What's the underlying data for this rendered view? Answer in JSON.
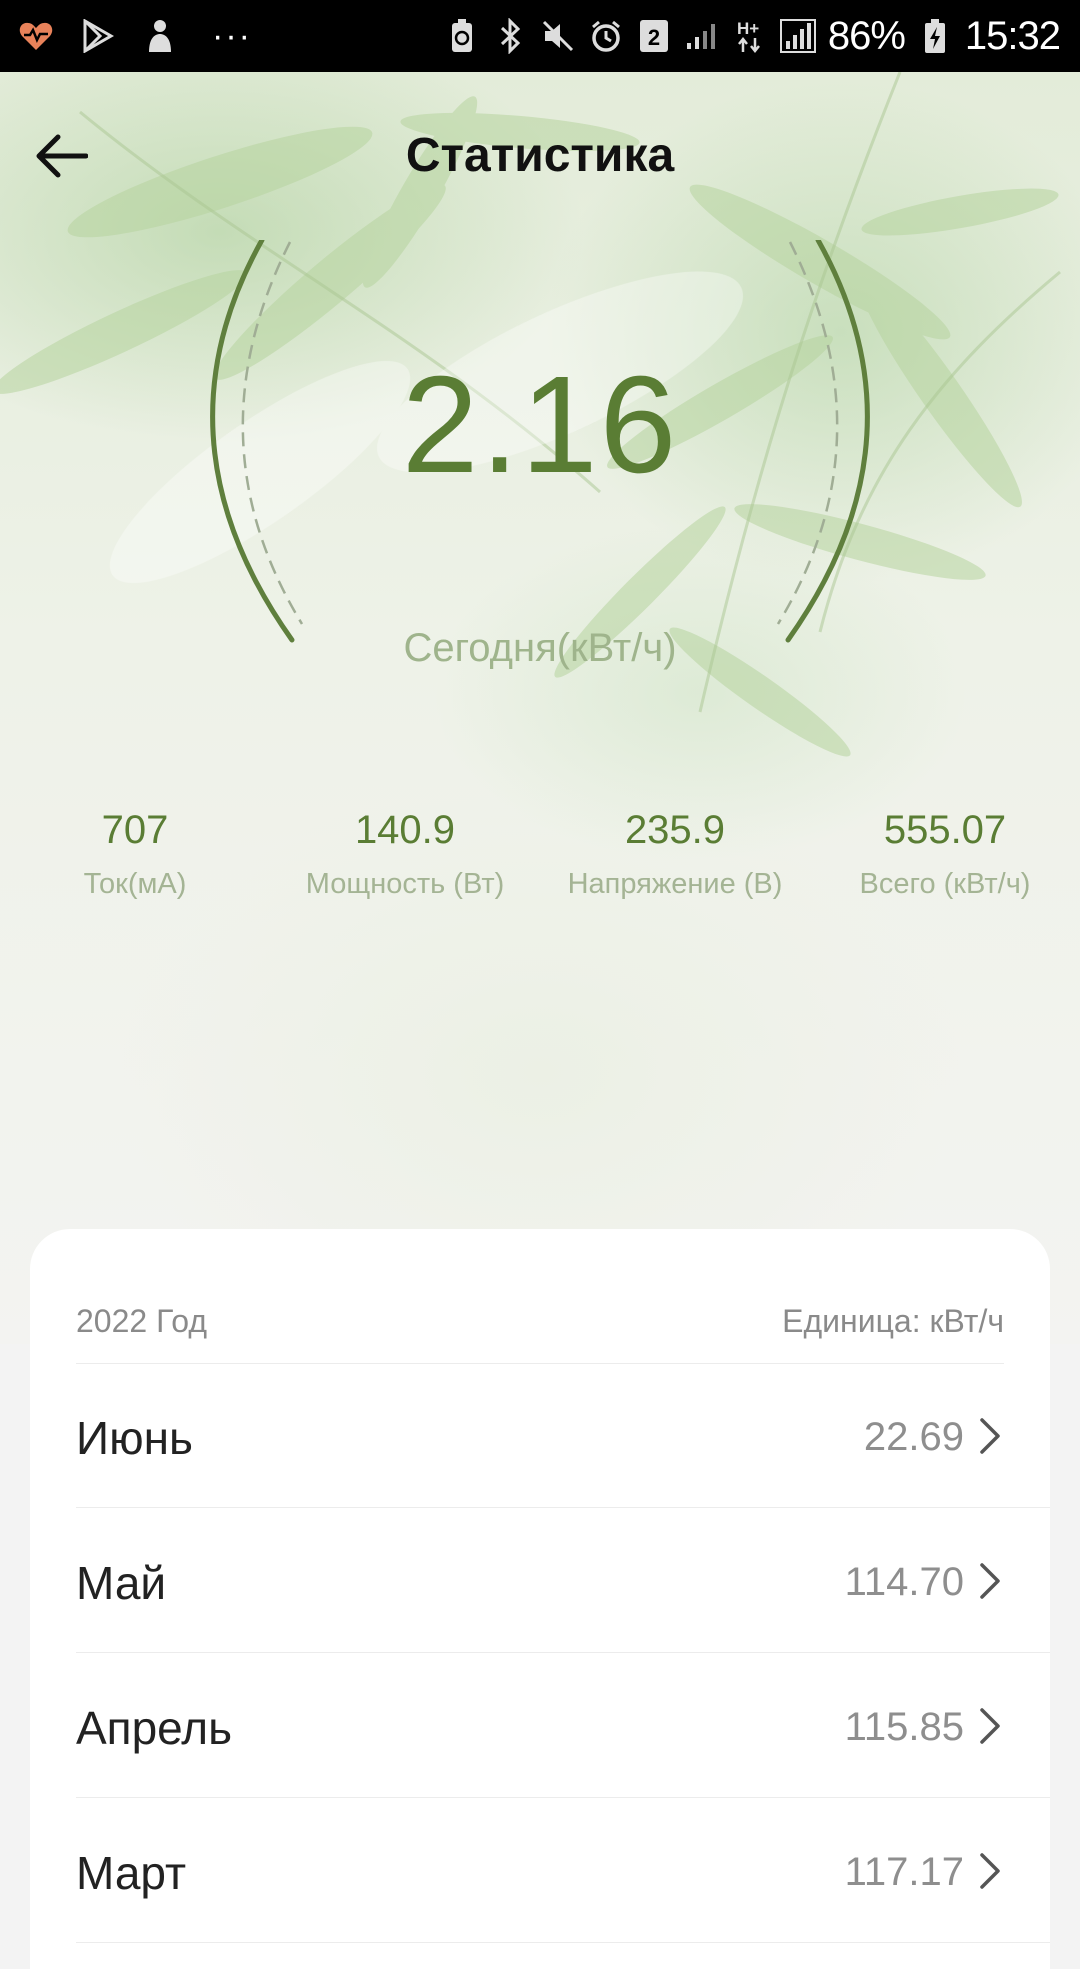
{
  "status_bar": {
    "battery_percent": "86%",
    "time": "15:32",
    "dots": "···",
    "sim_slot": "2",
    "icons": [
      "heart-health-icon",
      "play-store-icon",
      "cleaner-icon",
      "battery-saver-icon",
      "bluetooth-icon",
      "mute-icon",
      "alarm-icon",
      "sim-2-icon",
      "signal-icon",
      "h-plus-data-icon",
      "signal-full-icon",
      "battery-charging-icon"
    ]
  },
  "header": {
    "title": "Статистика"
  },
  "gauge": {
    "value": "2.16",
    "label": "Сегодня(кВт/ч)"
  },
  "metrics": [
    {
      "value": "707",
      "label": "Ток(мА)"
    },
    {
      "value": "140.9",
      "label": "Мощность (Вт)"
    },
    {
      "value": "235.9",
      "label": "Напряжение (В)"
    },
    {
      "value": "555.07",
      "label": "Всего (кВт/ч)"
    }
  ],
  "card": {
    "year": "2022 Год",
    "unit": "Единица: кВт/ч",
    "months": [
      {
        "name": "Июнь",
        "value": "22.69"
      },
      {
        "name": "Май",
        "value": "114.70"
      },
      {
        "name": "Апрель",
        "value": "115.85"
      },
      {
        "name": "Март",
        "value": "117.17"
      }
    ]
  },
  "colors": {
    "accent": "#5a7d34",
    "muted_green": "#9fb48c",
    "status_bar": "#000000",
    "heart_icon": "#e8825a"
  }
}
